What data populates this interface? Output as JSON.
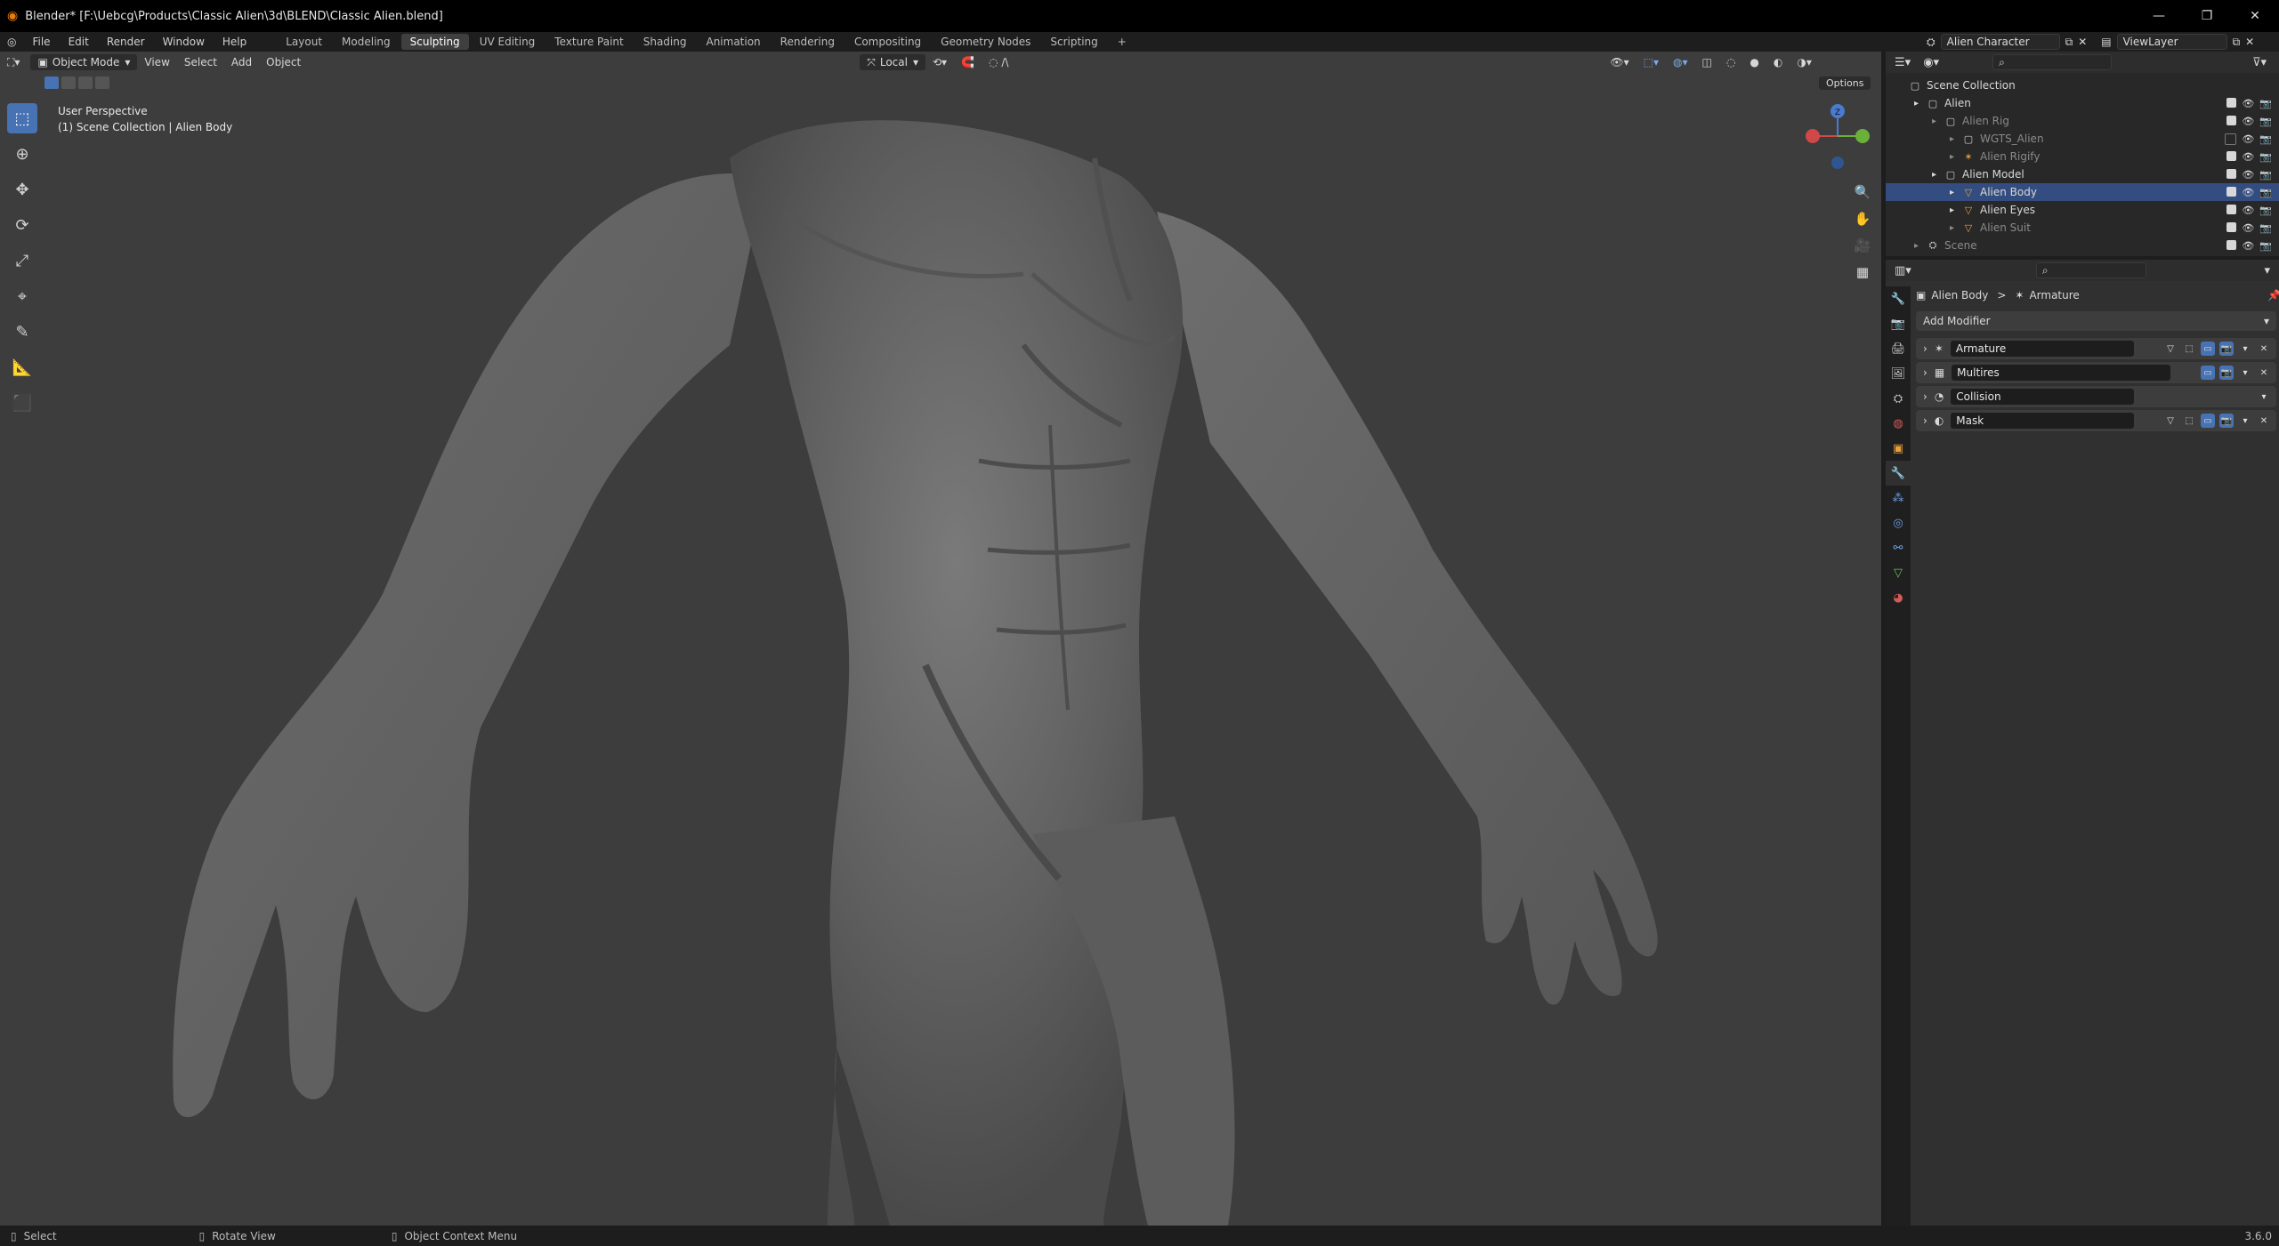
{
  "window": {
    "title": "Blender* [F:\\Uebcg\\Products\\Classic Alien\\3d\\BLEND\\Classic Alien.blend]",
    "controls": [
      "—",
      "❐",
      "✕"
    ]
  },
  "menu": {
    "items": [
      "File",
      "Edit",
      "Render",
      "Window",
      "Help"
    ],
    "workspaces": [
      "Layout",
      "Modeling",
      "Sculpting",
      "UV Editing",
      "Texture Paint",
      "Shading",
      "Animation",
      "Rendering",
      "Compositing",
      "Geometry Nodes",
      "Scripting"
    ],
    "active_workspace": "Sculpting",
    "add_tab": "+"
  },
  "scene_selector": "Alien Character",
  "view_layer": "ViewLayer",
  "viewport": {
    "mode": "Object Mode",
    "menus": [
      "View",
      "Select",
      "Add",
      "Object"
    ],
    "transform_orientation": "Local",
    "options_label": "Options",
    "info_line1": "User Perspective",
    "info_line2": "(1) Scene Collection | Alien Body",
    "gizmo_labels": {
      "z": "Z",
      "x": "X",
      "y": "Y"
    },
    "tools": [
      "select",
      "cursor",
      "move",
      "rotate",
      "scale",
      "transform",
      "annotate",
      "measure",
      "add-cube"
    ],
    "colors": {
      "background": "#3d3d3d",
      "active_tool": "#4772b3"
    }
  },
  "outliner": {
    "search_placeholder": "",
    "rows": [
      {
        "label": "Scene Collection",
        "indent": 0,
        "dim": false
      },
      {
        "label": "Alien",
        "indent": 1,
        "dim": false
      },
      {
        "label": "Alien Rig",
        "indent": 2,
        "dim": true
      },
      {
        "label": "WGTS_Alien",
        "indent": 3,
        "dim": true
      },
      {
        "label": "Alien Rigify",
        "indent": 3,
        "dim": true
      },
      {
        "label": "Alien Model",
        "indent": 2,
        "dim": false
      },
      {
        "label": "Alien Body",
        "indent": 3,
        "dim": false
      },
      {
        "label": "Alien Eyes",
        "indent": 3,
        "dim": false
      },
      {
        "label": "Alien Suit",
        "indent": 3,
        "dim": true
      },
      {
        "label": "Scene",
        "indent": 1,
        "dim": true
      }
    ]
  },
  "properties": {
    "breadcrumb_object": "Alien Body",
    "breadcrumb_sep": ">",
    "breadcrumb_modifier": "Armature",
    "add_modifier_label": "Add Modifier",
    "modifiers": [
      {
        "name": "Armature",
        "icon": "armature-icon"
      },
      {
        "name": "Multires",
        "icon": "multires-icon"
      },
      {
        "name": "Collision",
        "icon": "collision-icon"
      },
      {
        "name": "Mask",
        "icon": "mask-icon"
      }
    ]
  },
  "status": {
    "left_mouse": "Select",
    "middle_mouse": "Rotate View",
    "right_mouse": "Object Context Menu",
    "version": "3.6.0"
  }
}
